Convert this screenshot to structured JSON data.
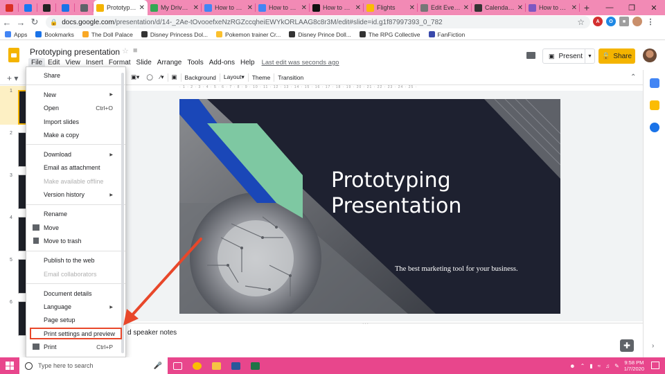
{
  "browser": {
    "tabs": [
      {
        "label": "",
        "icon": "gmail-icon",
        "color": "#d93025",
        "small": true
      },
      {
        "label": "",
        "icon": "facebook-icon",
        "color": "#1877f2",
        "small": true
      },
      {
        "label": "",
        "icon": "imdb-icon",
        "color": "#222222",
        "small": true
      },
      {
        "label": "",
        "icon": "bookmark-icon",
        "color": "#1a73e8",
        "small": true
      },
      {
        "label": "",
        "icon": "wifi-icon",
        "color": "#5f6368",
        "small": true
      },
      {
        "label": "Prototyping",
        "icon": "slides-icon",
        "color": "#f4b400",
        "active": true
      },
      {
        "label": "My Drive - G",
        "icon": "drive-icon",
        "color": "#34a853"
      },
      {
        "label": "How to hide",
        "icon": "docs-icon",
        "color": "#4285f4"
      },
      {
        "label": "How to print",
        "icon": "docs-icon",
        "color": "#4285f4"
      },
      {
        "label": "How to chan",
        "icon": "bi-icon",
        "color": "#111111"
      },
      {
        "label": "Flights",
        "icon": "flights-icon",
        "color": "#fbbc04"
      },
      {
        "label": "Edit Event -",
        "icon": "calendar-icon",
        "color": "#777777"
      },
      {
        "label": "Calendar - F",
        "icon": "mt-icon",
        "color": "#333333"
      },
      {
        "label": "How to Add",
        "icon": "purple-icon",
        "color": "#7e57c2"
      }
    ],
    "url_host": "docs.google.com",
    "url_path": "/presentation/d/14-_2Ae-tOvooefxeNzRGZccqheiEWYkORLAAG8c8r3M/edit#slide=id.g1f87997393_0_782",
    "bookmarks": [
      {
        "label": "Apps",
        "color": "#4285f4"
      },
      {
        "label": "Bookmarks",
        "color": "#1a73e8"
      },
      {
        "label": "The Doll Palace",
        "color": "#f9a825"
      },
      {
        "label": "Disney Princess Dol...",
        "color": "#333333"
      },
      {
        "label": "Pokemon trainer Cr...",
        "color": "#fbc02d"
      },
      {
        "label": "Disney Prince Doll...",
        "color": "#333333"
      },
      {
        "label": "The RPG Collective",
        "color": "#333333"
      },
      {
        "label": "FanFiction",
        "color": "#3949ab"
      }
    ]
  },
  "doc": {
    "title": "Prototyping presentation",
    "menus": [
      "File",
      "Edit",
      "View",
      "Insert",
      "Format",
      "Slide",
      "Arrange",
      "Tools",
      "Add-ons",
      "Help"
    ],
    "last_edit": "Last edit was seconds ago",
    "present_label": "Present",
    "share_label": "Share"
  },
  "toolbar": {
    "background": "Background",
    "layout": "Layout",
    "theme": "Theme",
    "transition": "Transition"
  },
  "ruler": "· 1 · 2 · 3 · 4 · 5 · 6 · 7 · 8 · 9 · 10 · 11 · 12 · 13 · 14 · 15 · 16 · 17 · 18 · 19 · 20 · 21 · 22 · 23 · 24 · 25 ·",
  "filmstrip": [
    "1",
    "2",
    "3",
    "4",
    "5",
    "6"
  ],
  "slide": {
    "title": "Prototyping\nPresentation",
    "subtitle": "The best marketing tool for your business.",
    "colors": {
      "background": "#1e2130",
      "blue": "#1a47b8",
      "green": "#7ec8a2"
    }
  },
  "notes_placeholder": "d speaker notes",
  "file_menu": {
    "groups": [
      [
        {
          "label": "Share"
        }
      ],
      [
        {
          "label": "New",
          "submenu": true
        },
        {
          "label": "Open",
          "shortcut": "Ctrl+O"
        },
        {
          "label": "Import slides"
        },
        {
          "label": "Make a copy"
        }
      ],
      [
        {
          "label": "Download",
          "submenu": true
        },
        {
          "label": "Email as attachment"
        },
        {
          "label": "Make available offline",
          "disabled": true
        },
        {
          "label": "Version history",
          "submenu": true
        }
      ],
      [
        {
          "label": "Rename"
        },
        {
          "label": "Move",
          "icon": "folder-icon"
        },
        {
          "label": "Move to trash",
          "icon": "trash-icon"
        }
      ],
      [
        {
          "label": "Publish to the web"
        },
        {
          "label": "Email collaborators",
          "disabled": true
        }
      ],
      [
        {
          "label": "Document details"
        },
        {
          "label": "Language",
          "submenu": true
        },
        {
          "label": "Page setup"
        },
        {
          "label": "Print settings and preview",
          "highlight": true
        },
        {
          "label": "Print",
          "shortcut": "Ctrl+P",
          "icon": "print-icon"
        }
      ]
    ]
  },
  "annotation_color": "#e8472a",
  "taskbar": {
    "search_placeholder": "Type here to search",
    "time": "9:58 PM",
    "date": "1/7/2020"
  }
}
